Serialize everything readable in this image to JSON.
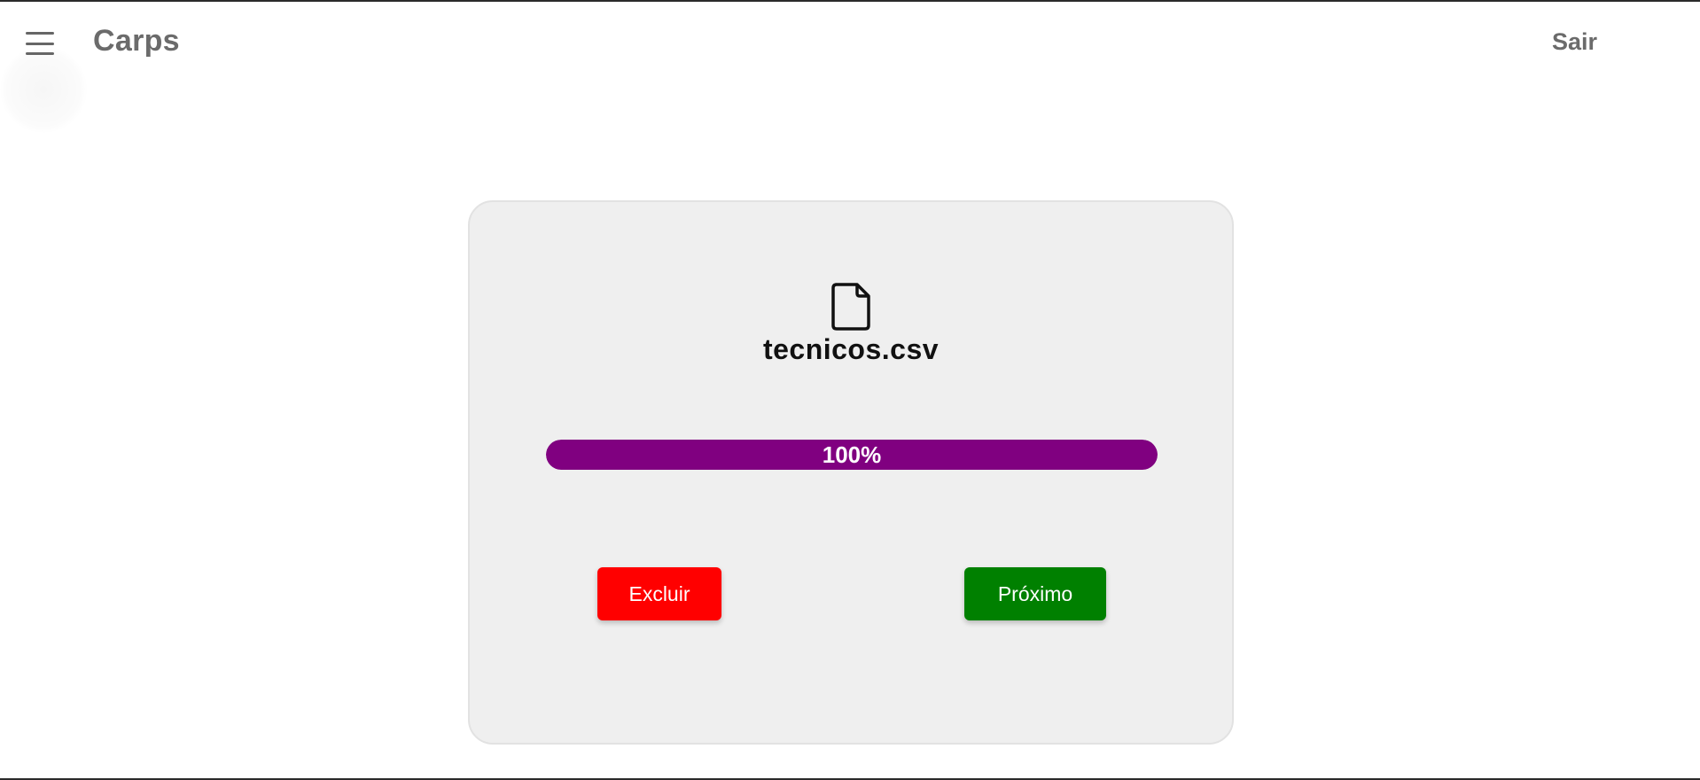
{
  "header": {
    "menu_icon": "hamburger-menu-icon",
    "title": "Carps",
    "logout_label": "Sair"
  },
  "upload": {
    "file_icon": "file-icon",
    "file_name": "tecnicos.csv",
    "progress_fraction": 1.0,
    "progress_text": "100%",
    "progress_color": "#800080"
  },
  "actions": {
    "delete_label": "Excluir",
    "delete_color": "#ff0000",
    "next_label": "Próximo",
    "next_color": "#008000"
  }
}
